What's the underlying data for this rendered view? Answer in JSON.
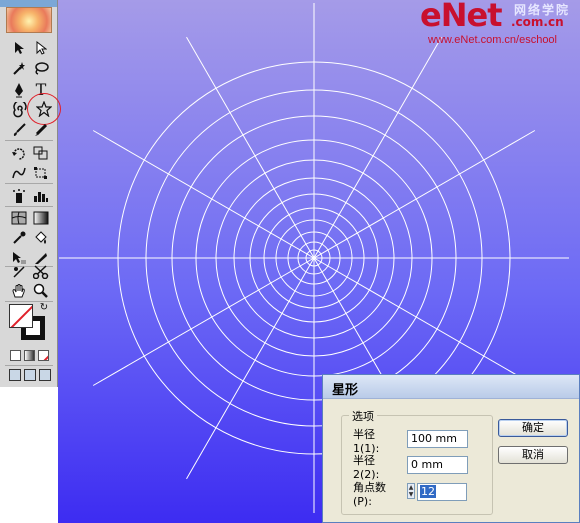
{
  "watermark": {
    "brand": "eNet",
    "cn_name": "网络学院",
    "domain_suffix": ".com.cn",
    "url": "www.eNet.com.cn/eschool"
  },
  "toolbox": {
    "tools": [
      "selection-icon",
      "direct-selection-icon",
      "magic-wand-icon",
      "lasso-icon",
      "pen-icon",
      "type-icon",
      "spiral-icon",
      "star-icon",
      "paintbrush-icon",
      "pencil-icon",
      "rotate-icon",
      "scale-icon",
      "warp-icon",
      "free-transform-icon",
      "symbol-sprayer-icon",
      "column-graph-icon",
      "mesh-icon",
      "gradient-icon",
      "eyedropper-icon",
      "live-paint-bucket-icon",
      "live-paint-selection-icon",
      "slice-icon",
      "scissors-icon",
      "hand-icon",
      "zoom-icon"
    ],
    "highlighted_tool": "star-icon",
    "highlight_color": "#e0202a"
  },
  "dialog": {
    "title": "星形",
    "group_label": "选项",
    "fields": [
      {
        "label": "半径 1(1):",
        "value": "100 mm"
      },
      {
        "label": "半径 2(2):",
        "value": "0 mm"
      },
      {
        "label": "角点数(P):",
        "value": "12"
      }
    ],
    "ok_label": "确定",
    "cancel_label": "取消"
  },
  "colors": {
    "canvas_top": "#a59be8",
    "canvas_bottom": "#3d2cf2",
    "web_lines": "#ffffff",
    "brand_red": "#c8102e"
  }
}
